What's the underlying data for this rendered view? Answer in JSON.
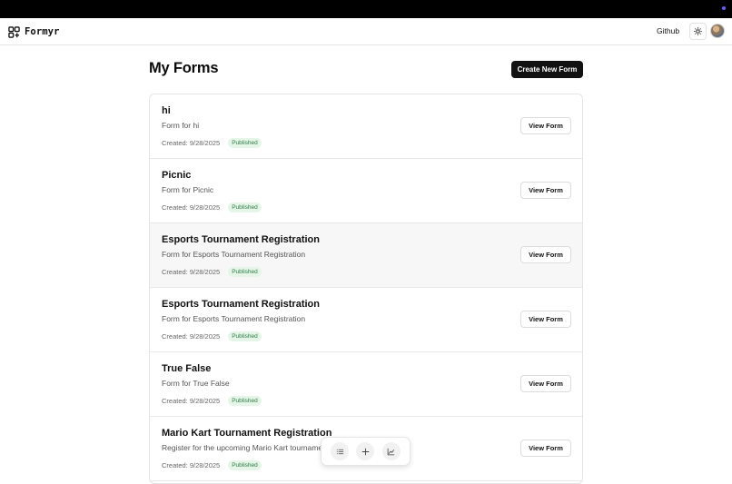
{
  "header": {
    "brand_name": "Formyr",
    "brand_icon": "form-grid-icon",
    "github_label": "Github",
    "theme_icon": "sun-icon"
  },
  "main": {
    "title": "My Forms",
    "create_label": "Create New Form"
  },
  "forms": [
    {
      "title": "hi",
      "description": "Form for hi",
      "created": "Created: 9/28/2025",
      "status": "Published",
      "action": "View Form"
    },
    {
      "title": "Picnic",
      "description": "Form for Picnic",
      "created": "Created: 9/28/2025",
      "status": "Published",
      "action": "View Form"
    },
    {
      "title": "Esports Tournament Registration",
      "description": "Form for Esports Tournament Registration",
      "created": "Created: 9/28/2025",
      "status": "Published",
      "action": "View Form"
    },
    {
      "title": "Esports Tournament Registration",
      "description": "Form for Esports Tournament Registration",
      "created": "Created: 9/28/2025",
      "status": "Published",
      "action": "View Form"
    },
    {
      "title": "True False",
      "description": "Form for True False",
      "created": "Created: 9/28/2025",
      "status": "Published",
      "action": "View Form"
    },
    {
      "title": "Mario Kart Tournament Registration",
      "description": "Register for the upcoming Mario Kart tournament",
      "created": "Created: 9/28/2025",
      "status": "Published",
      "action": "View Form"
    }
  ],
  "dock": {
    "icons": [
      "list-icon",
      "plus-icon",
      "chart-icon"
    ]
  },
  "colors": {
    "primary_button": "#111111",
    "badge_bg": "#e5f6e9",
    "badge_text": "#2f7a44",
    "hover_row": "#f7f7f8"
  }
}
